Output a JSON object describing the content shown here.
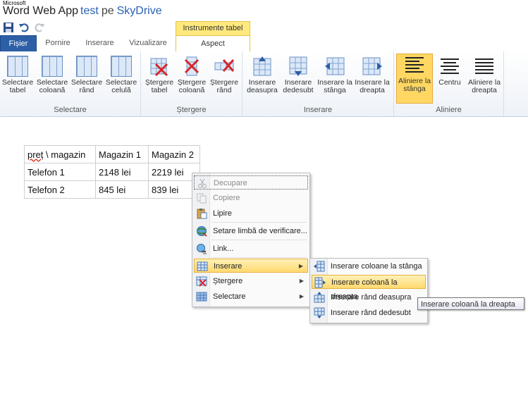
{
  "app": {
    "brand_small": "Microsoft",
    "name": "Word Web App",
    "document": "test",
    "connector": "pe",
    "service": "SkyDrive"
  },
  "ribbon": {
    "contextual_group": "Instrumente tabel",
    "tabs": [
      "Fișier",
      "Pornire",
      "Inserare",
      "Vizualizare",
      "Aspect"
    ],
    "groups": [
      {
        "label": "Selectare",
        "buttons": [
          "Selectare tabel",
          "Selectare coloană",
          "Selectare rând",
          "Selectare celulă"
        ]
      },
      {
        "label": "Ștergere",
        "buttons": [
          "Ștergere tabel",
          "Ștergere coloană",
          "Ștergere rând"
        ]
      },
      {
        "label": "Inserare",
        "buttons": [
          "Inserare deasupra",
          "Inserare dedesubt",
          "Inserare la stânga",
          "Inserare la dreapta"
        ]
      },
      {
        "label": "Aliniere",
        "buttons": [
          "Aliniere la stânga",
          "Centru",
          "Aliniere la dreapta"
        ]
      }
    ],
    "selected_button": "Aliniere la stânga"
  },
  "table": {
    "rows": [
      [
        "preț \\ magazin",
        "Magazin 1",
        "Magazin 2"
      ],
      [
        "Telefon 1",
        "2148 lei",
        "2219 lei"
      ],
      [
        "Telefon 2",
        "845 lei",
        "839 lei"
      ]
    ],
    "misspelled_word": "preț"
  },
  "context_menu": {
    "items": [
      {
        "label": "Decupare",
        "icon": "scissors-icon",
        "disabled": true
      },
      {
        "label": "Copiere",
        "icon": "copy-icon",
        "disabled": true
      },
      {
        "label": "Lipire",
        "icon": "paste-icon",
        "disabled": false
      },
      {
        "label": "Setare limbă de verificare...",
        "icon": "language-icon",
        "disabled": false
      },
      {
        "label": "Link...",
        "icon": "link-icon",
        "disabled": false
      },
      {
        "label": "Inserare",
        "icon": "insert-table-icon",
        "disabled": false,
        "submenu": true,
        "highlighted": true
      },
      {
        "label": "Ștergere",
        "icon": "delete-table-icon",
        "disabled": false,
        "submenu": true
      },
      {
        "label": "Selectare",
        "icon": "select-table-icon",
        "disabled": false,
        "submenu": true
      }
    ]
  },
  "submenu": {
    "items": [
      {
        "label": "Inserare coloane la stânga",
        "icon": "insert-column-left-icon"
      },
      {
        "label": "Inserare coloană la dreapta",
        "icon": "insert-column-right-icon",
        "highlighted": true
      },
      {
        "label": "Inserare rând deasupra",
        "icon": "insert-row-above-icon"
      },
      {
        "label": "Inserare rând dedesubt",
        "icon": "insert-row-below-icon"
      }
    ]
  },
  "tooltip": "Inserare coloană la dreapta"
}
